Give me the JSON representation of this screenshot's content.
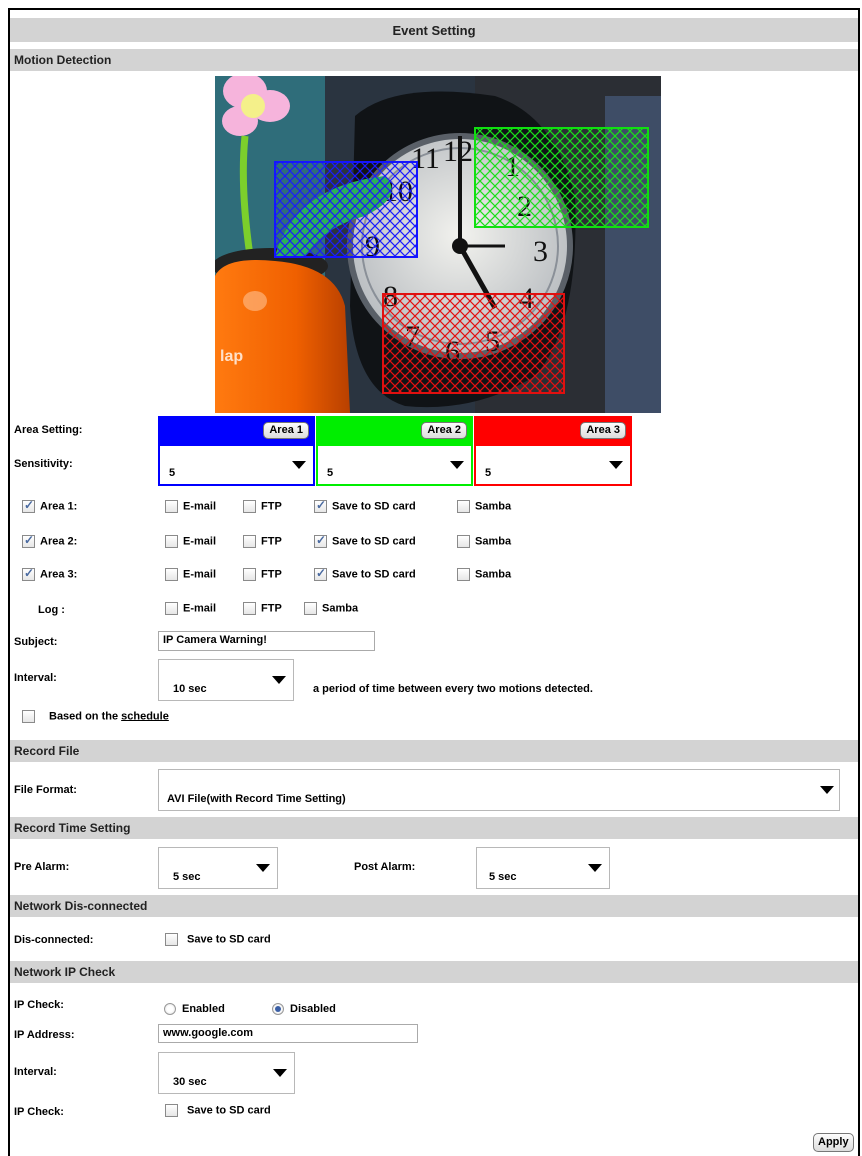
{
  "page_title": "Event Setting",
  "sections": {
    "motion": "Motion Detection",
    "record_file": "Record File",
    "record_time": "Record Time Setting",
    "network_disconnected": "Network Dis-connected",
    "network_ip_check": "Network IP Check"
  },
  "motion": {
    "image_overlay_text": "lap",
    "area_setting_label": "Area Setting:",
    "sensitivity_label": "Sensitivity:",
    "areas": [
      {
        "button": "Area 1",
        "color": "#0000ff",
        "sensitivity": "5"
      },
      {
        "button": "Area 2",
        "color": "#00ee00",
        "sensitivity": "5"
      },
      {
        "button": "Area 3",
        "color": "#ff0000",
        "sensitivity": "5"
      }
    ],
    "area_rows": [
      {
        "label": "Area 1:",
        "checked": true
      },
      {
        "label": "Area 2:",
        "checked": true
      },
      {
        "label": "Area 3:",
        "checked": true
      }
    ],
    "actions": {
      "email": "E-mail",
      "ftp": "FTP",
      "sd": "Save to SD card",
      "samba": "Samba"
    },
    "log_label": "Log :",
    "subject_label": "Subject:",
    "subject_value": "IP Camera Warning!",
    "interval_label": "Interval:",
    "interval_value": "10 sec",
    "interval_note": "a period of time between every two motions detected.",
    "schedule_prefix": "Based on the",
    "schedule_link": "schedule"
  },
  "record_file": {
    "label": "File Format:",
    "value": "AVI File(with Record Time Setting)"
  },
  "record_time": {
    "pre_label": "Pre Alarm:",
    "pre_value": "5 sec",
    "post_label": "Post Alarm:",
    "post_value": "5 sec"
  },
  "disconnected": {
    "label": "Dis-connected:",
    "option": "Save to SD card"
  },
  "ip_check": {
    "check_label": "IP Check:",
    "enabled": "Enabled",
    "disabled": "Disabled",
    "selected": "Disabled",
    "address_label": "IP Address:",
    "address_value": "www.google.com",
    "interval_label": "Interval:",
    "interval_value": "30 sec",
    "check2_label": "IP Check:",
    "sd_option": "Save to SD card"
  },
  "apply_label": "Apply",
  "colors": {
    "header_bg": "#d3d3d3",
    "area1": "#0000ff",
    "area2": "#00ee00",
    "area3": "#ff0000"
  }
}
